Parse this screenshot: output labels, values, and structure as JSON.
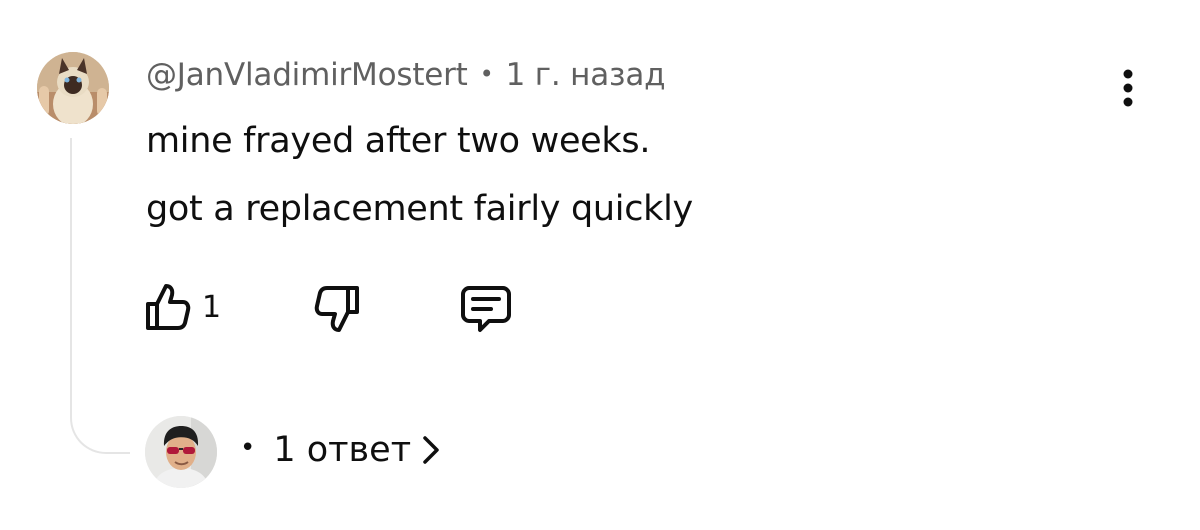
{
  "comment": {
    "author": "@JanVladimirMostert",
    "separator": "•",
    "time": "1 г. назад",
    "text_lines": [
      "mine frayed after two weeks.",
      "got a replacement fairly quickly"
    ],
    "avatar_icon": "cat-avatar",
    "menu_icon": "more-vertical-icon"
  },
  "actions": {
    "like_icon": "thumbs-up-icon",
    "like_count": "1",
    "dislike_icon": "thumbs-down-icon",
    "reply_icon": "comment-reply-icon"
  },
  "replies": {
    "bullet": "•",
    "label": "1 ответ",
    "chevron_icon": "chevron-right-icon",
    "avatar_icon": "person-avatar"
  },
  "colors": {
    "text": "#0f0f0f",
    "meta": "#606060",
    "thread_line": "#e5e5e5",
    "background": "#ffffff"
  }
}
